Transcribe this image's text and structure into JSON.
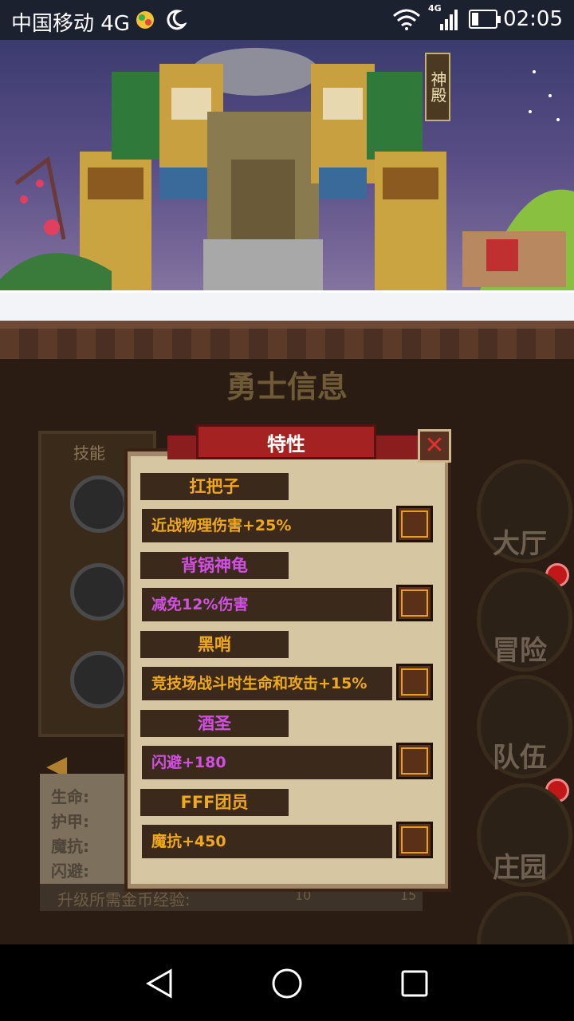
{
  "status_bar": {
    "carrier": "中国移动 4G",
    "network": "4G",
    "time": "02:05",
    "battery_level": 0.3
  },
  "scene": {
    "sign": "神殿"
  },
  "menu": {
    "title": "勇士信息",
    "skills_label": "技能",
    "stats": [
      {
        "label": "生命:"
      },
      {
        "label": "护甲:"
      },
      {
        "label": "魔抗:"
      },
      {
        "label": "闪避:"
      }
    ],
    "upgrade_label": "升级所需金币经验:",
    "upgrade_values": [
      "10",
      "15"
    ],
    "side_buttons": [
      {
        "label": "大厅",
        "badge": true
      },
      {
        "label": "冒险",
        "badge": false
      },
      {
        "label": "队伍",
        "badge": true
      },
      {
        "label": "庄园",
        "badge": false
      }
    ]
  },
  "dialog": {
    "title": "特性",
    "close": "✕",
    "traits": [
      {
        "name": "扛把子",
        "description": "近战物理伤害+25%",
        "color": "gold"
      },
      {
        "name": "背锅神龟",
        "description": "减免12%伤害",
        "color": "purple"
      },
      {
        "name": "黑哨",
        "description": "竞技场战斗时生命和攻击+15%",
        "color": "gold"
      },
      {
        "name": "酒圣",
        "description": "闪避+180",
        "color": "purple"
      },
      {
        "name": "FFF团员",
        "description": "魔抗+450",
        "color": "gold"
      }
    ]
  },
  "colors": {
    "gold_text": "#f0a81c",
    "purple_text": "#d050e0",
    "ribbon": "#a52222"
  }
}
